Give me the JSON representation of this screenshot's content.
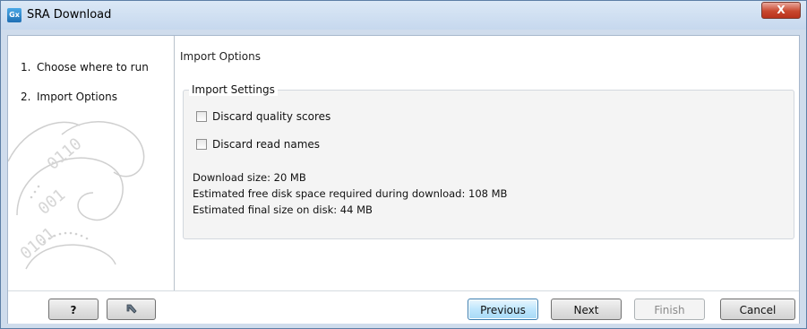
{
  "window": {
    "title": "SRA Download",
    "app_icon_text": "Gx",
    "close_symbol": "X",
    "icons": {
      "app": "gx-app-icon",
      "close": "close-icon"
    }
  },
  "steps": [
    {
      "number": "1.",
      "label": "Choose where to run"
    },
    {
      "number": "2.",
      "label": "Import Options"
    }
  ],
  "content": {
    "header": "Import Options",
    "settings_legend": "Import Settings",
    "checkboxes": [
      {
        "label": "Discard quality scores",
        "checked": false
      },
      {
        "label": "Discard read names",
        "checked": false
      }
    ],
    "info_lines": [
      "Download size: 20 MB",
      "Estimated free disk space required during download: 108 MB",
      "Estimated final size on disk: 44 MB"
    ]
  },
  "footer": {
    "help_label": "?",
    "reset_icon": "reset-arrow-icon",
    "previous_label": "Previous",
    "next_label": "Next",
    "finish_label": "Finish",
    "cancel_label": "Cancel"
  },
  "colors": {
    "title_bar": "#cfdcec",
    "close_button": "#c9482f",
    "focused_button": "#bee6fd"
  }
}
